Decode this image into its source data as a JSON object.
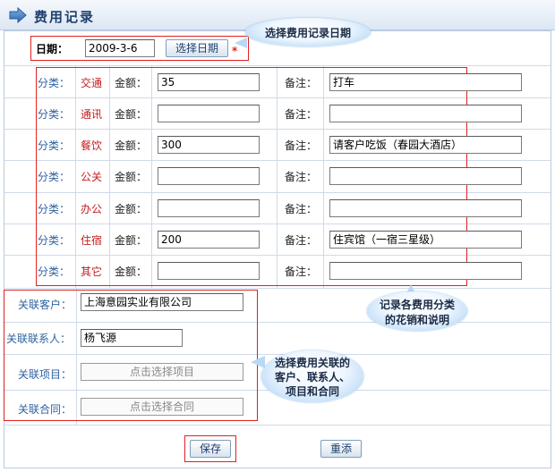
{
  "title": "费用记录",
  "date": {
    "label": "日期：",
    "value": "2009-3-6",
    "button": "选择日期",
    "required_mark": "*"
  },
  "labels": {
    "category": "分类：",
    "amount": "金额：",
    "remark": "备注："
  },
  "expenses": [
    {
      "category": "交通",
      "amount": "35",
      "remark": "打车"
    },
    {
      "category": "通讯",
      "amount": "",
      "remark": ""
    },
    {
      "category": "餐饮",
      "amount": "300",
      "remark": "请客户吃饭（春园大酒店）"
    },
    {
      "category": "公关",
      "amount": "",
      "remark": ""
    },
    {
      "category": "办公",
      "amount": "",
      "remark": ""
    },
    {
      "category": "住宿",
      "amount": "200",
      "remark": "住宾馆（一宿三星级）"
    },
    {
      "category": "其它",
      "amount": "",
      "remark": ""
    }
  ],
  "related": {
    "customer": {
      "label": "关联客户：",
      "value": "上海意园实业有限公司"
    },
    "contact": {
      "label": "关联联系人：",
      "value": "杨飞源"
    },
    "project": {
      "label": "关联项目：",
      "placeholder": "点击选择项目"
    },
    "contract": {
      "label": "关联合同：",
      "placeholder": "点击选择合同"
    }
  },
  "buttons": {
    "save": "保存",
    "reset": "重添"
  },
  "callouts": {
    "date": "选择费用记录日期",
    "categories": [
      "记录各费用分类",
      "的花销和说明"
    ],
    "related": [
      "选择费用关联的",
      "客户、联系人、",
      "项目和合同"
    ]
  },
  "colors": {
    "accent_red": "#e02020",
    "label_blue": "#2d63a0",
    "category_red": "#c31e1e"
  }
}
